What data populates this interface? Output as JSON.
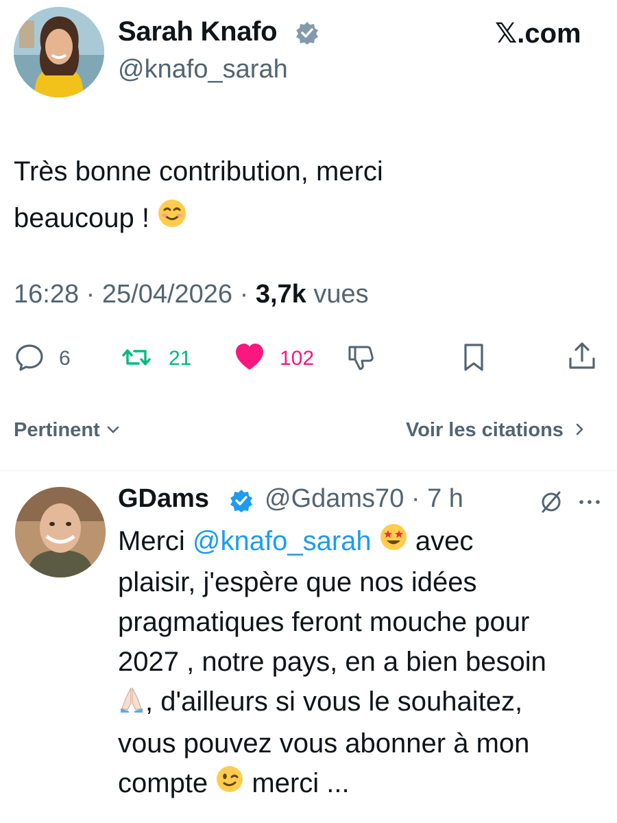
{
  "header": {
    "site_logo": "𝕏.com"
  },
  "tweet": {
    "author_name": "Sarah Knafo",
    "author_handle": "@knafo_sarah",
    "verified": true,
    "text_line1": "Très bonne contribution, merci",
    "text_line2": "beaucoup !",
    "text_emoji": "smiling-face-icon",
    "time": "16:28",
    "date": "25/04/2026",
    "views_count": "3,7k",
    "views_label": "vues",
    "separator": "·",
    "actions": {
      "replies": "6",
      "reposts": "21",
      "likes": "102"
    }
  },
  "sort": {
    "label": "Pertinent",
    "citations_label": "Voir les citations"
  },
  "reply": {
    "author_name": "GDams",
    "author_handle": "@Gdams70",
    "time": "7 h",
    "text_start": "Merci ",
    "mention": "@knafo_sarah",
    "text_after_mention": " avec",
    "text_line2": "plaisir, j'espère que nos idées",
    "text_line3": "pragmatiques feront mouche pour",
    "text_line4": "2027 , notre pays, en a bien besoin",
    "text_line5": ", d'ailleurs si vous le souhaitez,",
    "text_line6": "vous pouvez vous abonner à mon",
    "text_line7_start": "compte ",
    "text_line7_end": " merci ..."
  },
  "colors": {
    "accent_blue": "#1d9bf0",
    "repost_green": "#00ba7c",
    "like_pink": "#f91880",
    "muted": "#536471",
    "text": "#0f1419"
  }
}
